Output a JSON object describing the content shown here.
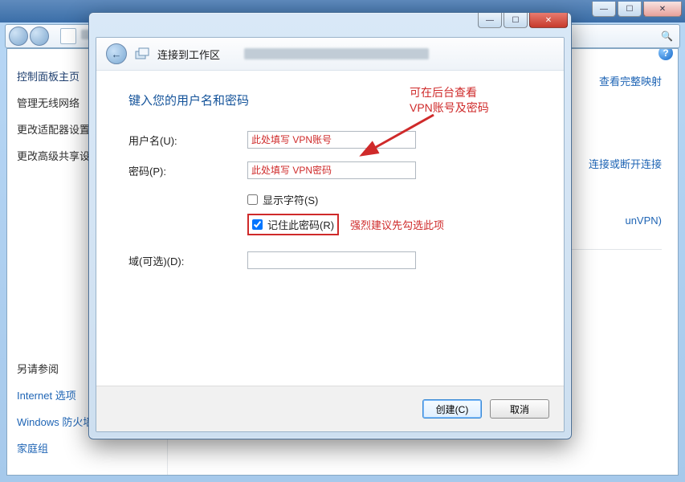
{
  "outer": {
    "sidebar": {
      "heading": "控制面板主页",
      "links": [
        "管理无线网络",
        "更改适配器设置",
        "更改高级共享设置"
      ],
      "see_also_heading": "另请参阅",
      "bottom_links": [
        "Internet 选项",
        "Windows 防火墙",
        "家庭组"
      ]
    },
    "main_links": {
      "view_full_map": "查看完整映射",
      "connect_disconnect": "连接或断开连接",
      "unvpn": "unVPN)"
    },
    "help_icon": "?"
  },
  "wizard": {
    "header_title": "连接到工作区",
    "heading": "键入您的用户名和密码",
    "fields": {
      "username_label": "用户名(U):",
      "username_placeholder": "此处填写 VPN账号",
      "password_label": "密码(P):",
      "password_placeholder": "此处填写 VPN密码",
      "show_chars_label": "显示字符(S)",
      "remember_label": "记住此密码(R)",
      "domain_label": "域(可选)(D):"
    },
    "buttons": {
      "create": "创建(C)",
      "cancel": "取消"
    }
  },
  "annotations": {
    "top_note_line1": "可在后台查看",
    "top_note_line2": "VPN账号及密码",
    "remember_advice": "强烈建议先勾选此项"
  },
  "glyphs": {
    "minimize": "—",
    "maximize": "☐",
    "close": "✕",
    "back": "←",
    "search": "🔍"
  }
}
